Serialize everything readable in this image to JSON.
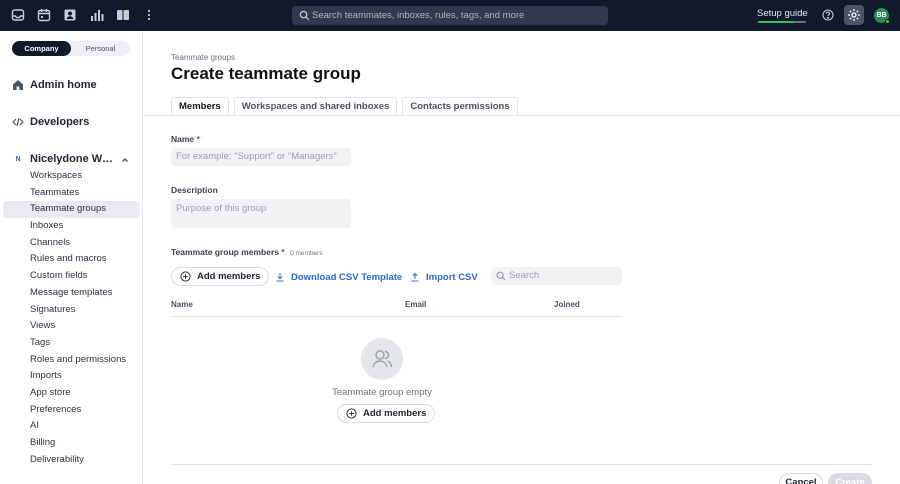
{
  "topbar": {
    "icons": [
      "inbox-icon",
      "calendar-icon",
      "contacts-icon",
      "analytics-icon",
      "knowledge-base-icon",
      "more-vertical-icon"
    ],
    "search_placeholder": "Search teammates, inboxes, rules, tags, and more",
    "setup_guide_label": "Setup guide",
    "setup_progress": 0.75,
    "user_initials": "BB"
  },
  "sidebar": {
    "segment": {
      "company": "Company",
      "personal": "Personal",
      "selected": "Company"
    },
    "admin_home": "Admin home",
    "developers": "Developers",
    "workspace": {
      "badge": "N",
      "name": "Nicelydone Workspace"
    },
    "items": [
      "Workspaces",
      "Teammates",
      "Teammate groups",
      "Inboxes",
      "Channels",
      "Rules and macros",
      "Custom fields",
      "Message templates",
      "Signatures",
      "Views",
      "Tags",
      "Roles and permissions",
      "Imports",
      "App store",
      "Preferences",
      "AI",
      "Billing",
      "Deliverability"
    ],
    "active_item": "Teammate groups"
  },
  "main": {
    "breadcrumb": "Teammate groups",
    "title": "Create teammate group",
    "tabs": [
      "Members",
      "Workspaces and shared inboxes",
      "Contacts permissions"
    ],
    "active_tab": "Members",
    "name_label": "Name",
    "required_mark": "*",
    "name_placeholder": "For example: \"Support\" or \"Managers\"",
    "description_label": "Description",
    "description_placeholder": "Purpose of this group",
    "members_label": "Teammate group members",
    "members_count": "0 members",
    "add_members": "Add members",
    "download_csv": "Download CSV Template",
    "import_csv": "Import CSV",
    "search_placeholder": "Search",
    "columns": [
      "Name",
      "Email",
      "Joined"
    ],
    "empty_text": "Teammate group empty",
    "cancel": "Cancel",
    "create": "Create"
  },
  "colors": {
    "topbar_bg": "#0f1a2c",
    "accent_link": "#2f66d0",
    "progress_green": "#2fbf5a",
    "avatar_green": "#2e8b57"
  }
}
